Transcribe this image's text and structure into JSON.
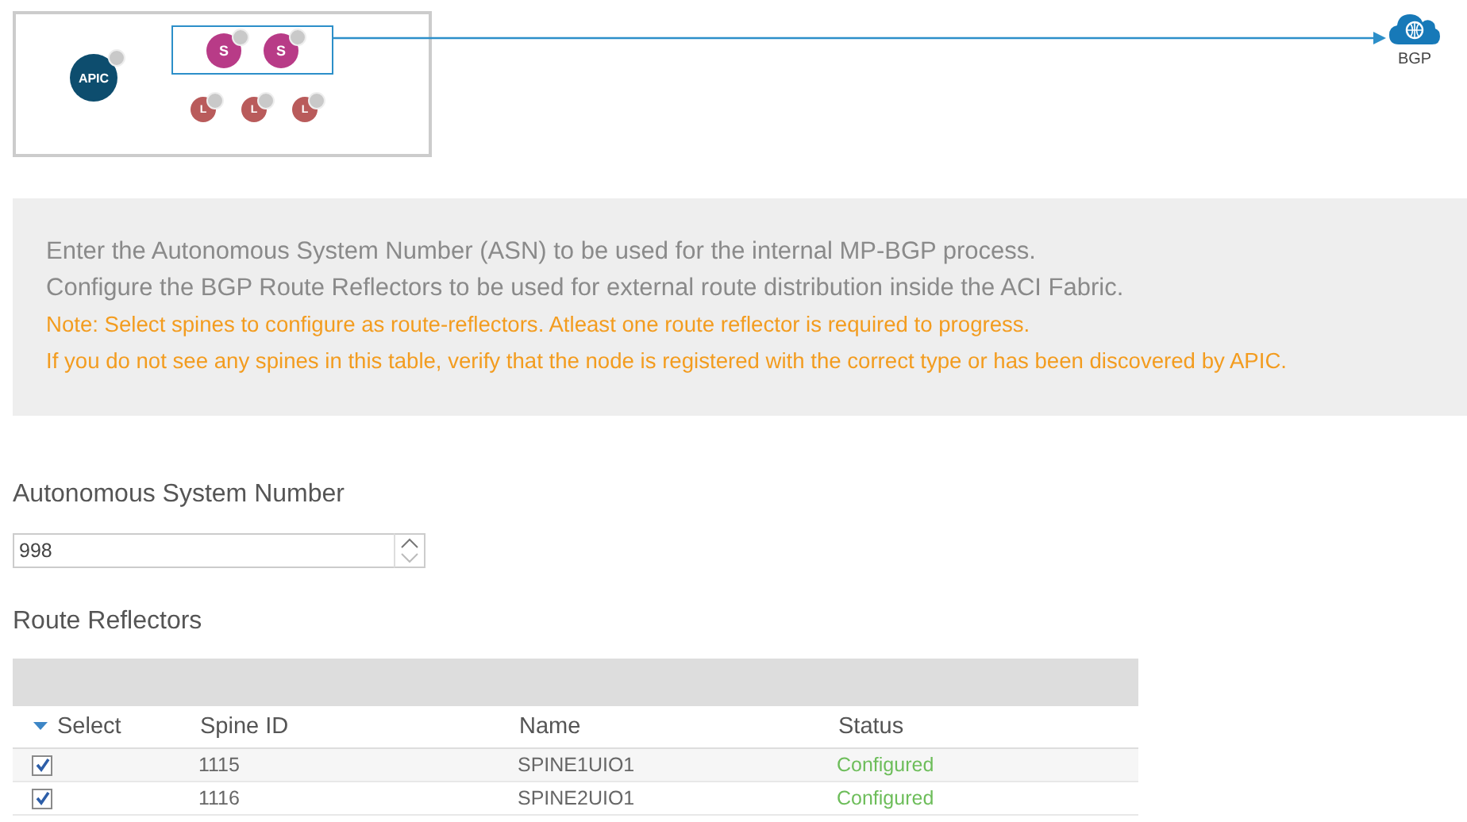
{
  "topology": {
    "nodes": [
      {
        "kind": "controller",
        "label": "APIC"
      },
      {
        "kind": "spine",
        "label": "S"
      },
      {
        "kind": "spine",
        "label": "S"
      },
      {
        "kind": "leaf",
        "label": "L"
      },
      {
        "kind": "leaf",
        "label": "L"
      },
      {
        "kind": "leaf",
        "label": "L"
      }
    ],
    "external": {
      "label": "BGP"
    }
  },
  "info": [
    {
      "kind": "normal",
      "text": "Enter the Autonomous System Number (ASN) to be used for the internal MP-BGP process."
    },
    {
      "kind": "normal",
      "text": "Configure the BGP Route Reflectors to be used for external route distribution inside the ACI Fabric."
    },
    {
      "kind": "note",
      "text": "Note: Select spines to configure as route-reflectors. Atleast one route reflector is required to progress."
    },
    {
      "kind": "note",
      "text": "If you do not see any spines in this table, verify that the node is registered with the correct type or has been discovered by APIC."
    }
  ],
  "asn": {
    "label": "Autonomous System Number",
    "value": "998"
  },
  "route_reflectors": {
    "title": "Route Reflectors",
    "columns": [
      "Select",
      "Spine ID",
      "Name",
      "Status"
    ],
    "rows": [
      {
        "checked": true,
        "spine_id": "1115",
        "name": "SPINE1UIO1",
        "status": "Configured"
      },
      {
        "checked": true,
        "spine_id": "1116",
        "name": "SPINE2UIO1",
        "status": "Configured"
      }
    ]
  }
}
